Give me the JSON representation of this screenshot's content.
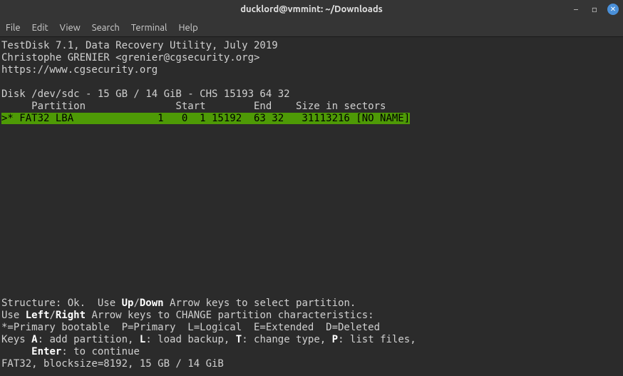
{
  "window": {
    "title": "ducklord@vmmint: ~/Downloads"
  },
  "menubar": {
    "file": "File",
    "edit": "Edit",
    "view": "View",
    "search": "Search",
    "terminal": "Terminal",
    "help": "Help"
  },
  "testdisk": {
    "header1": "TestDisk 7.1, Data Recovery Utility, July 2019",
    "header2": "Christophe GRENIER <grenier@cgsecurity.org>",
    "header3": "https://www.cgsecurity.org",
    "disk_line": "Disk /dev/sdc - 15 GB / 14 GiB - CHS 15193 64 32",
    "table_header": "     Partition               Start        End    Size in sectors",
    "partition_row": ">* FAT32 LBA              1   0  1 15192  63 32   31113216 [NO NAME]",
    "structure_line_pre": "Structure: Ok.  Use ",
    "up": "Up",
    "slash1": "/",
    "down": "Down",
    "structure_line_post": " Arrow keys to select partition.",
    "use_pre": "Use ",
    "left": "Left",
    "slash2": "/",
    "right": "Right",
    "use_post": " Arrow keys to CHANGE partition characteristics:",
    "legend": "*=Primary bootable  P=Primary  L=Logical  E=Extended  D=Deleted",
    "keys_pre": "Keys ",
    "key_a": "A",
    "key_a_txt": ": add partition, ",
    "key_l": "L",
    "key_l_txt": ": load backup, ",
    "key_t": "T",
    "key_t_txt": ": change type, ",
    "key_p": "P",
    "key_p_txt": ": list files,",
    "enter_indent": "     ",
    "enter": "Enter",
    "enter_txt": ": to continue",
    "fs_info": "FAT32, blocksize=8192, 15 GB / 14 GiB"
  }
}
